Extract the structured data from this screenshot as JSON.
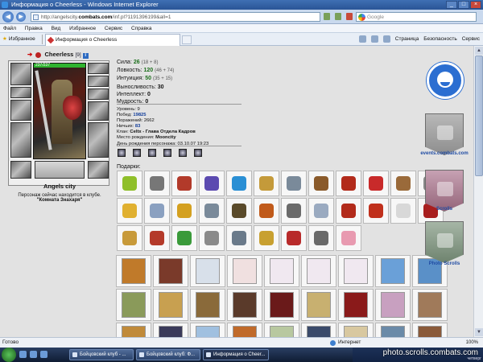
{
  "window": {
    "title": "Информация о Cheerless - Windows Internet Explorer"
  },
  "address": {
    "prefix": "http://angelscity.",
    "domain": "combats.com",
    "path": "/inf.pl?1191396199&all=1"
  },
  "search": {
    "placeholder": "Google"
  },
  "menu": [
    "Файл",
    "Правка",
    "Вид",
    "Избранное",
    "Сервис",
    "Справка"
  ],
  "favorites": "Избранное",
  "tab": {
    "title": "Информация о Cheerless"
  },
  "commands": [
    "Страница",
    "Безопасность",
    "Сервис"
  ],
  "character": {
    "name": "Cheerless",
    "level": "[9]",
    "hp": "237/237",
    "city": "Angels city",
    "location_text": "Персонаж сейчас находится в клубе.",
    "room": "\"Комната Знахаря\""
  },
  "stats": [
    {
      "label": "Сила:",
      "value": "26",
      "extra": "(18 + 8)"
    },
    {
      "label": "Ловкость:",
      "value": "120",
      "extra": "(46 + 74)"
    },
    {
      "label": "Интуиция:",
      "value": "50",
      "extra": "(35 + 15)"
    },
    {
      "label": "Выносливость:",
      "value": "30",
      "extra": ""
    },
    {
      "label": "Интеллект:",
      "value": "0",
      "extra": ""
    },
    {
      "label": "Мудрость:",
      "value": "0",
      "extra": ""
    }
  ],
  "info": {
    "level": "Уровень: 9",
    "wins_label": "Побед:",
    "wins": "19825",
    "losses": "Поражений: 2662",
    "draws_label": "Ничьих:",
    "draws": "83",
    "clan_label": "Клан:",
    "clan": "Celtx - Глава Отдела Кадров",
    "birthplace_label": "Место рождения:",
    "birthplace": "Mooncity",
    "birthday": "День рождения персонажа: 03.10.07 19:23"
  },
  "gifts_label": "Подарки:",
  "gifts": [
    {
      "icon": "leaf",
      "color": "#8fbf2a"
    },
    {
      "icon": "arrows",
      "color": "#777777"
    },
    {
      "icon": "book",
      "color": "#b23a2a"
    },
    {
      "icon": "tome",
      "color": "#5b4ab0"
    },
    {
      "icon": "crystal",
      "color": "#2a8fd4"
    },
    {
      "icon": "camel",
      "color": "#c49a3a"
    },
    {
      "icon": "gem",
      "color": "#7a8a9a"
    },
    {
      "icon": "mug",
      "color": "#8a5a2a"
    },
    {
      "icon": "banner",
      "color": "#b22a1a"
    },
    {
      "icon": "scroll",
      "color": "#c82a2a"
    },
    {
      "icon": "basket",
      "color": "#9a6a3a"
    },
    {
      "icon": "swords",
      "color": "#888888"
    },
    {
      "icon": "flower",
      "color": "#e0b030"
    },
    {
      "icon": "paper",
      "color": "#8aa0c0"
    },
    {
      "icon": "wreath",
      "color": "#d4a020"
    },
    {
      "icon": "figure",
      "color": "#7a8a9a"
    },
    {
      "icon": "painting",
      "color": "#5a4a2a"
    },
    {
      "icon": "candle",
      "color": "#c05a1a"
    },
    {
      "icon": "helmet",
      "color": "#6a6a6a"
    },
    {
      "icon": "bottle",
      "color": "#9aaac0"
    },
    {
      "icon": "banner",
      "color": "#b22a1a"
    },
    {
      "icon": "banner",
      "color": "#c0301c"
    },
    {
      "icon": "glass",
      "color": "#d8d8d8"
    },
    {
      "icon": "banner",
      "color": "#a81e1e"
    },
    {
      "icon": "necklace",
      "color": "#c89a3a"
    },
    {
      "icon": "horse",
      "color": "#b43a2a"
    },
    {
      "icon": "cloak",
      "color": "#3a9a3a"
    },
    {
      "icon": "knight",
      "color": "#8a8a8a"
    },
    {
      "icon": "ornament",
      "color": "#6a7a8a"
    },
    {
      "icon": "dragon",
      "color": "#c8a030"
    },
    {
      "icon": "cake",
      "color": "#b82a2a"
    },
    {
      "icon": "chest",
      "color": "#6a6a6a"
    },
    {
      "icon": "pig",
      "color": "#e89ab0"
    }
  ],
  "cards": [
    {
      "color": "#c07a2a"
    },
    {
      "color": "#7a3a2a"
    },
    {
      "color": "#d8e0ea"
    },
    {
      "color": "#f0e0e0"
    },
    {
      "color": "#f0e8f0"
    },
    {
      "color": "#f0e8f0"
    },
    {
      "color": "#f0e8f0"
    },
    {
      "color": "#6aa0d8"
    },
    {
      "color": "#5a90c8"
    },
    {
      "color": "#8a9a5a"
    },
    {
      "color": "#c8a050"
    },
    {
      "color": "#8a6a3a"
    },
    {
      "color": "#5a3a2a"
    },
    {
      "color": "#6a1a1a"
    },
    {
      "color": "#c8b070"
    },
    {
      "color": "#8a1a1a"
    },
    {
      "color": "#c8a0c0"
    },
    {
      "color": "#a07a5a"
    },
    {
      "color": "#c08a3a"
    },
    {
      "color": "#3a3a5a"
    },
    {
      "color": "#a0c0e0"
    },
    {
      "color": "#c06a2a"
    },
    {
      "color": "#b8c8a0"
    },
    {
      "color": "#3a4a6a"
    },
    {
      "color": "#d8c8a0"
    },
    {
      "color": "#6a8aa8"
    },
    {
      "color": "#8a5a3a"
    }
  ],
  "side": {
    "logo": "combats-logo",
    "events_label": "events.combats.com",
    "scrolls_label": "Scrolls",
    "photo_label": "Photo Scrolls"
  },
  "status": {
    "ready": "Готово",
    "zone": "Интернет",
    "zoom": "100%"
  },
  "taskbar": {
    "tasks": [
      "Бойцовский клуб - ...",
      "Бойцовский клуб: Ф...",
      "Информация о Cheer..."
    ],
    "watermark": "photo.scrolls.combats.com",
    "day": "четверг"
  }
}
